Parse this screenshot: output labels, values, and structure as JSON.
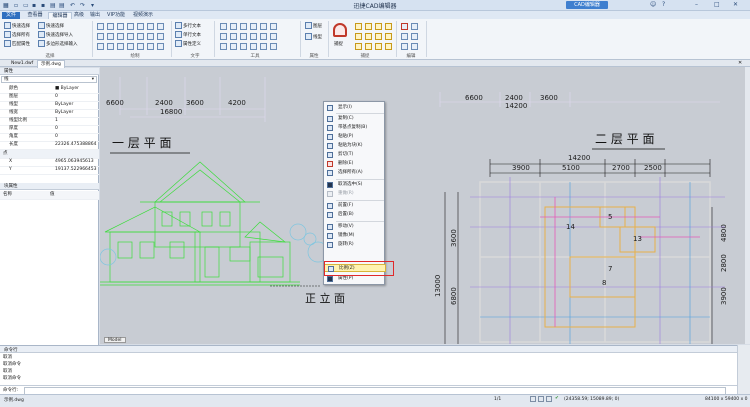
{
  "app": {
    "title": "迅捷CAD编辑器",
    "badge": "CAD编辑器"
  },
  "ribbon_tabs": [
    "文件",
    "查看器",
    "编辑器",
    "高级",
    "输出",
    "VIP功能",
    "视频演示"
  ],
  "ribbon": {
    "select_group": {
      "label": "选择",
      "buttons": [
        "快速选择",
        "选择所有",
        "匹配属性",
        "快速选择",
        "快速选择导入",
        "多边形选择输入"
      ]
    },
    "draw_group": {
      "label": "绘制"
    },
    "text_group": {
      "label": "文字",
      "buttons": [
        "多行文本",
        "单行文本",
        "属性定义"
      ]
    },
    "tools_group": {
      "label": "工具"
    },
    "props_group": {
      "label": "属性",
      "buttons": [
        "图层",
        "线型"
      ]
    },
    "snap_group": {
      "label": "捕捉",
      "button": "捕捉"
    },
    "edit_group": {
      "label": "编辑"
    }
  },
  "doc_tabs": [
    "New1.dwf",
    "示例.dwg"
  ],
  "properties": {
    "header": "属性",
    "filter": "线",
    "rows": [
      {
        "k": "颜色",
        "v": "■ ByLayer"
      },
      {
        "k": "图层",
        "v": "0"
      },
      {
        "k": "线型",
        "v": "ByLayer"
      },
      {
        "k": "线宽",
        "v": "ByLayer"
      },
      {
        "k": "线型比例",
        "v": "1"
      },
      {
        "k": "厚度",
        "v": "0"
      },
      {
        "k": "角度",
        "v": "0"
      },
      {
        "k": "长度",
        "v": "22326.475388864"
      }
    ],
    "point_section": "点",
    "point_rows": [
      {
        "k": "X",
        "v": "4965.063945613"
      },
      {
        "k": "Y",
        "v": "19137.522966453"
      }
    ]
  },
  "blocks_panel": {
    "header": "块属性",
    "col1": "名称",
    "col2": "值"
  },
  "drawing": {
    "dim_left": [
      "6600",
      "2400",
      "3600",
      "4200"
    ],
    "dim_left_total": "16800",
    "dim_right_top": [
      "6600",
      "2400",
      "3600"
    ],
    "dim_right_total_top": "14200",
    "title_first_floor": "一 层 平 面",
    "title_second_floor": "二 层 平 面",
    "title_elevation": "正 立 面",
    "plan_width": "14200",
    "plan_dims": [
      "3900",
      "5100",
      "2700",
      "2500"
    ],
    "plan_vert": [
      "13000",
      "3600",
      "6800",
      "4800",
      "2800",
      "3900"
    ],
    "room_labels": [
      "5",
      "14",
      "13",
      "7",
      "8"
    ],
    "model_tab": "Model"
  },
  "context_menu": {
    "items": [
      {
        "label": "显示(I)",
        "enabled": true
      },
      {
        "label": "复制(C)",
        "enabled": true
      },
      {
        "label": "带基点复制(B)",
        "enabled": true
      },
      {
        "label": "粘贴(P)",
        "enabled": true
      },
      {
        "label": "粘贴为块(K)",
        "enabled": true
      },
      {
        "label": "剪切(T)",
        "enabled": true
      },
      {
        "label": "删除(E)",
        "enabled": true
      },
      {
        "label": "选择所有(A)",
        "enabled": true
      },
      {
        "label": "取消选中(S)",
        "enabled": true
      },
      {
        "label": "重做(R)",
        "enabled": false
      },
      {
        "label": "前置(F)",
        "enabled": true
      },
      {
        "label": "后置(B)",
        "enabled": true
      },
      {
        "label": "移动(V)",
        "enabled": true
      },
      {
        "label": "镜像(M)",
        "enabled": true
      },
      {
        "label": "旋转(R)",
        "enabled": true
      },
      {
        "label": "比例(Z)",
        "enabled": true
      },
      {
        "label": "属性(P)",
        "enabled": true
      }
    ]
  },
  "command": {
    "header": "命令行",
    "history": [
      "取消",
      "取消命令",
      "取消",
      "取消命令"
    ],
    "prompt": "命令行:",
    "value": ""
  },
  "status": {
    "filename": "示例.dwg",
    "page": "1/1",
    "coords": "(24358.59; 15089.89; 0)",
    "size": "84100 x 59400 x 0"
  },
  "colors": {
    "accent": "#2f6fc0",
    "canvas": "#c8ccd3",
    "green": "#3ddc3d",
    "highlight": "#e0292b"
  }
}
